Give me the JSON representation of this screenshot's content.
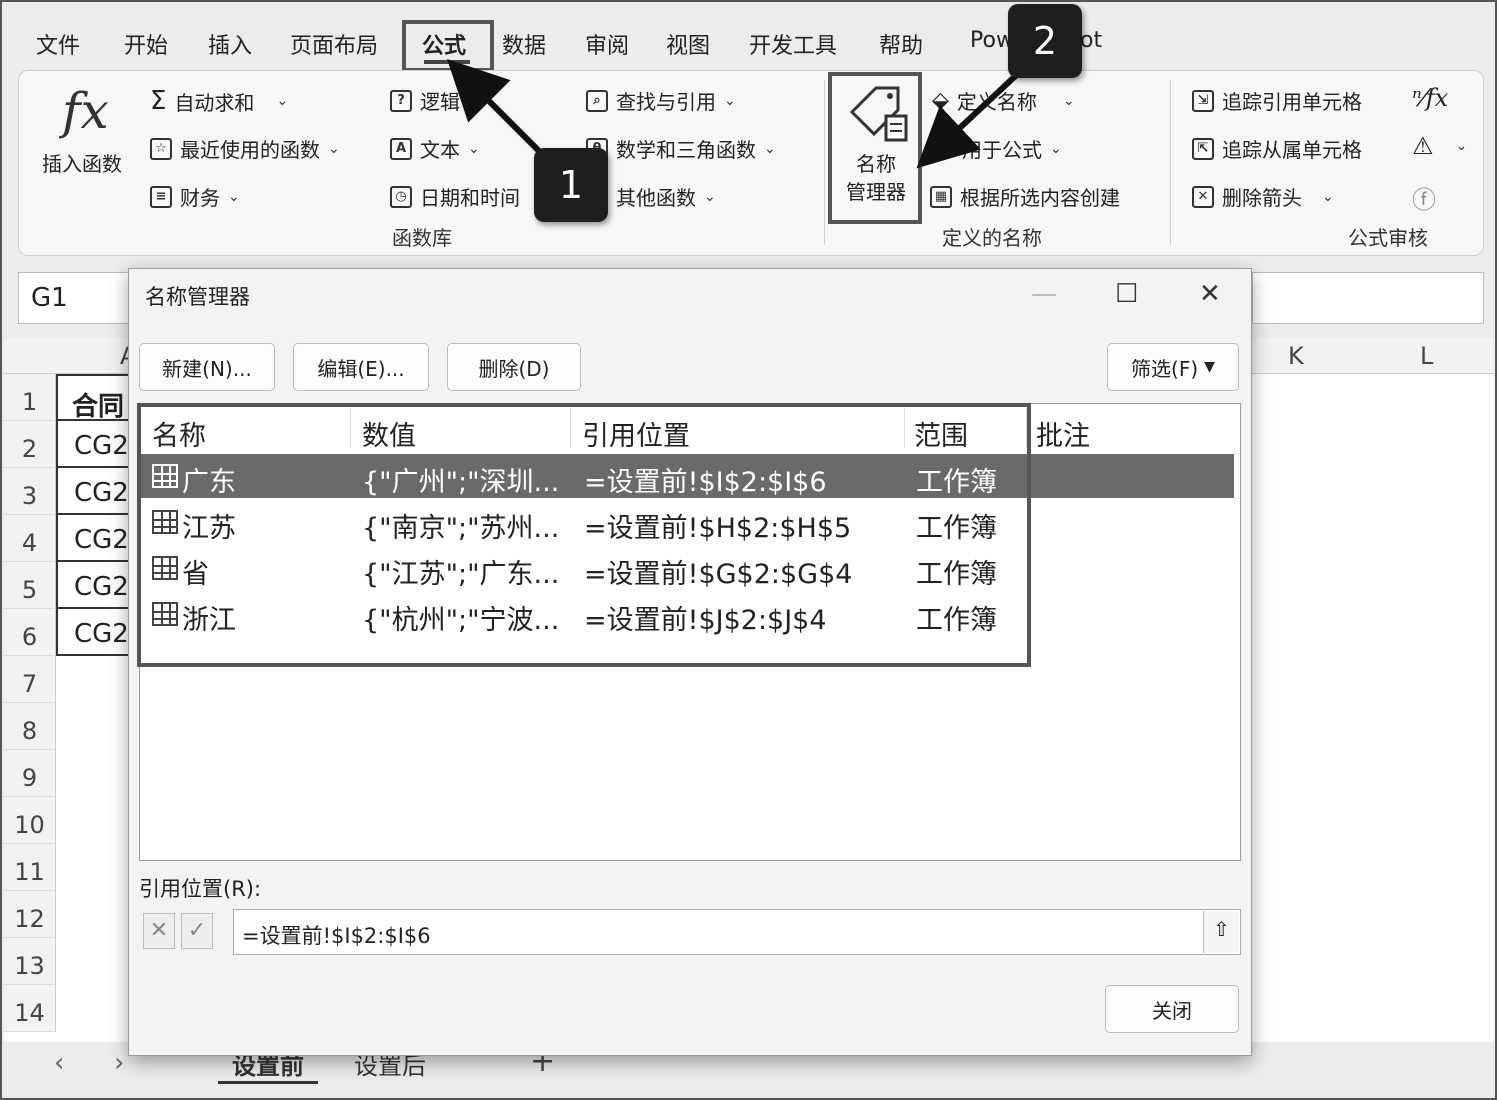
{
  "menu_tabs": [
    "文件",
    "开始",
    "插入",
    "页面布局",
    "公式",
    "数据",
    "审阅",
    "视图",
    "开发工具",
    "帮助",
    "Pow",
    "ot"
  ],
  "ribbon": {
    "insert_function": "插入函数",
    "function_library": {
      "items": [
        "自动求和",
        "最近使用的函数",
        "财务",
        "逻辑",
        "文本",
        "日期和时间",
        "查找与引用",
        "数学和三角函数",
        "其他函数"
      ],
      "label": "函数库"
    },
    "defined_names": {
      "name_manager": [
        "名称",
        "管理器"
      ],
      "define_name": "定义名称",
      "use_in_formula": "用于公式",
      "create_from_selection": "根据所选内容创建",
      "label": "定义的名称"
    },
    "formula_auditing": {
      "trace_precedents": "追踪引用单元格",
      "trace_dependents": "追踪从属单元格",
      "remove_arrows": "删除箭头",
      "label": "公式审核"
    }
  },
  "name_box": "G1",
  "sheet": {
    "columns": [
      "A",
      "K",
      "L"
    ],
    "rows": [
      "1",
      "2",
      "3",
      "4",
      "5",
      "6",
      "7",
      "8",
      "9",
      "10",
      "11",
      "12",
      "13",
      "14"
    ],
    "cells_a": [
      "合同",
      "CG2",
      "CG2",
      "CG2",
      "CG2",
      "CG2"
    ]
  },
  "sheet_tabs": [
    "设置前",
    "设置后"
  ],
  "dialog": {
    "title": "名称管理器",
    "buttons": {
      "new": "新建(N)...",
      "edit": "编辑(E)...",
      "delete": "删除(D)",
      "filter": "筛选(F)",
      "close": "关闭"
    },
    "columns": [
      "名称",
      "数值",
      "引用位置",
      "范围",
      "批注"
    ],
    "rows": [
      {
        "name": "广东",
        "value": "{\"广州\";\"深圳...",
        "ref": "=设置前!$I$2:$I$6",
        "scope": "工作簿",
        "selected": true
      },
      {
        "name": "江苏",
        "value": "{\"南京\";\"苏州...",
        "ref": "=设置前!$H$2:$H$5",
        "scope": "工作簿",
        "selected": false
      },
      {
        "name": "省",
        "value": "{\"江苏\";\"广东...",
        "ref": "=设置前!$G$2:$G$4",
        "scope": "工作簿",
        "selected": false
      },
      {
        "name": "浙江",
        "value": "{\"杭州\";\"宁波...",
        "ref": "=设置前!$J$2:$J$4",
        "scope": "工作簿",
        "selected": false
      }
    ],
    "ref_label": "引用位置(R):",
    "ref_value": "=设置前!$I$2:$I$6"
  },
  "callouts": [
    "1",
    "2"
  ],
  "icons": {
    "fx": "function-icon",
    "sum": "sigma-icon",
    "close": "close-icon",
    "maximize": "maximize-icon",
    "minimize": "minimize-icon"
  }
}
